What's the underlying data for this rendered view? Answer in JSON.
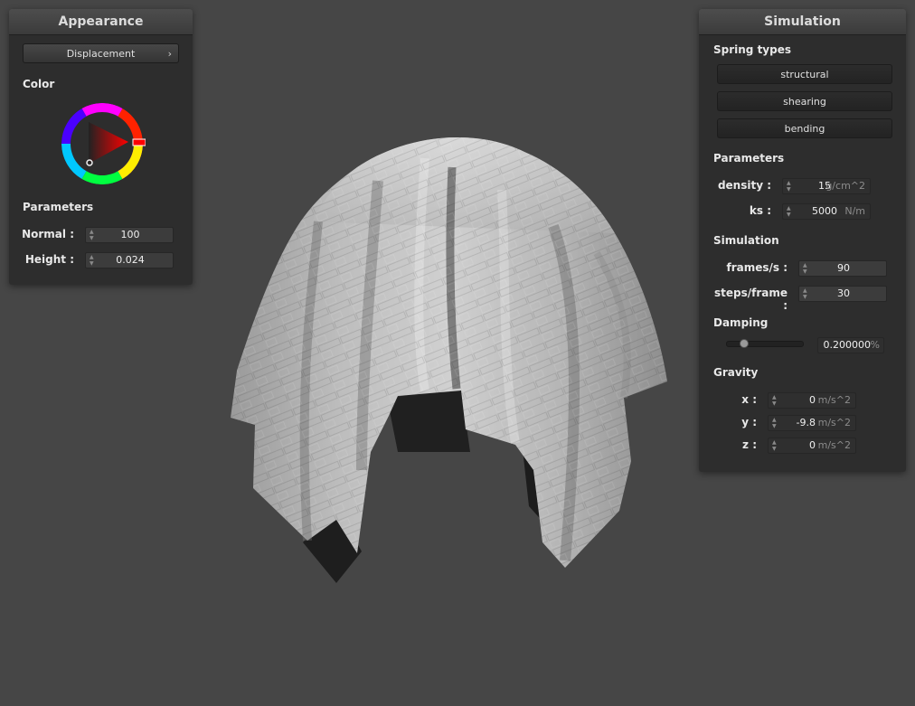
{
  "appearance": {
    "title": "Appearance",
    "mode_button": "Displacement",
    "color_label": "Color",
    "parameters_label": "Parameters",
    "normal_label": "Normal :",
    "normal_value": "100",
    "height_label": "Height :",
    "height_value": "0.024",
    "selected_hue_color": "#ff0000"
  },
  "simulation": {
    "title": "Simulation",
    "spring_types_label": "Spring types",
    "spring_buttons": [
      "structural",
      "shearing",
      "bending"
    ],
    "parameters_label": "Parameters",
    "density_label": "density :",
    "density_value": "15",
    "density_unit": "g/cm^2",
    "ks_label": "ks :",
    "ks_value": "5000",
    "ks_unit": "N/m",
    "simulation_label": "Simulation",
    "fps_label": "frames/s :",
    "fps_value": "90",
    "steps_label": "steps/frame :",
    "steps_value": "30",
    "damping_label": "Damping",
    "damping_value": "0.200000",
    "damping_unit": "%",
    "damping_slider_fraction": 0.2,
    "gravity_label": "Gravity",
    "gx_label": "x :",
    "gx_value": "0",
    "gy_label": "y :",
    "gy_value": "-9.8",
    "gz_label": "z :",
    "gz_value": "0",
    "gravity_unit": "m/s^2"
  },
  "viewport": {
    "background_color": "#464646",
    "cloth_color": "#a8a8a8"
  }
}
